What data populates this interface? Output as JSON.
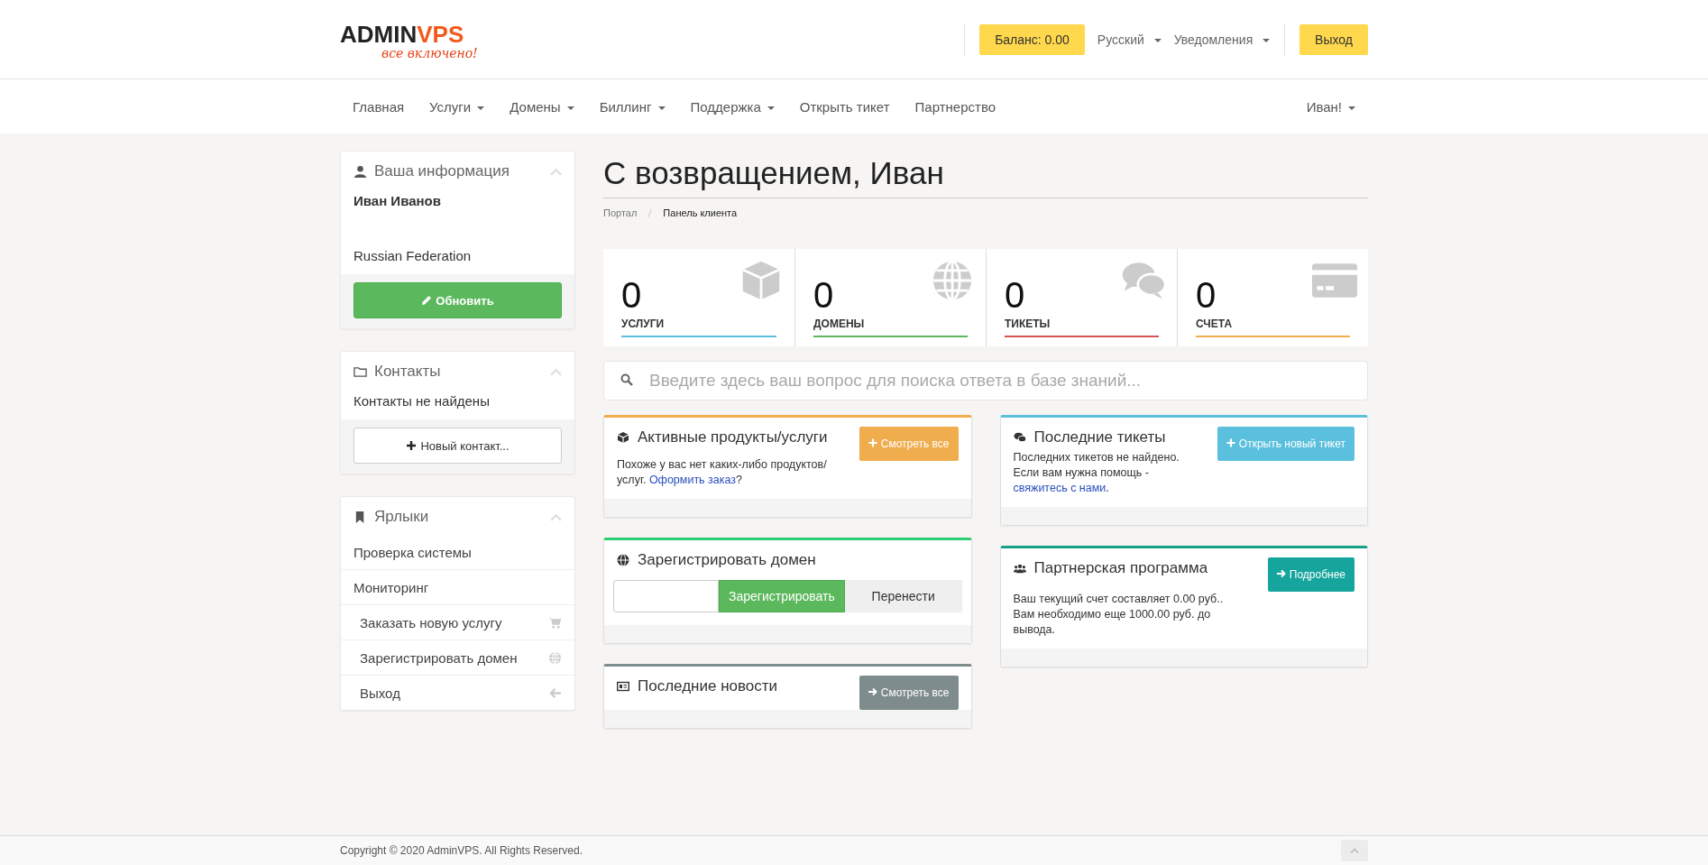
{
  "header": {
    "logo": {
      "name_start": "ADMIN",
      "name_end": "VPS",
      "tagline": "все включено!"
    },
    "balance_button": "Баланс: 0.00",
    "language": "Русский",
    "notifications": "Уведомления",
    "logout_button": "Выход"
  },
  "nav": {
    "items": [
      {
        "label": "Главная",
        "dropdown": false
      },
      {
        "label": "Услуги",
        "dropdown": true
      },
      {
        "label": "Домены",
        "dropdown": true
      },
      {
        "label": "Биллинг",
        "dropdown": true
      },
      {
        "label": "Поддержка",
        "dropdown": true
      },
      {
        "label": "Открыть тикет",
        "dropdown": false
      },
      {
        "label": "Партнерство",
        "dropdown": false
      }
    ],
    "user_menu": "Иван!"
  },
  "sidebar": {
    "your_info": {
      "title": "Ваша информация",
      "name": "Иван Иванов",
      "country": "Russian Federation",
      "update_button": "Обновить"
    },
    "contacts": {
      "title": "Контакты",
      "empty_text": "Контакты не найдены",
      "new_contact_button": "Новый контакт..."
    },
    "shortcuts": {
      "title": "Ярлыки",
      "items": [
        {
          "label": "Проверка системы",
          "kind": "plain"
        },
        {
          "label": "Мониторинг",
          "kind": "plain"
        },
        {
          "label": "Заказать новую услугу",
          "kind": "cart"
        },
        {
          "label": "Зарегистрировать домен",
          "kind": "globe"
        },
        {
          "label": "Выход",
          "kind": "back"
        }
      ]
    }
  },
  "main": {
    "title": "С возвращением, Иван",
    "breadcrumb": [
      {
        "label": "Портал",
        "selected": false
      },
      {
        "label": "Панель клиента",
        "selected": true
      }
    ],
    "stats": [
      {
        "count": "0",
        "label": "УСЛУГИ",
        "color": "#5bc0de",
        "kind": "box"
      },
      {
        "count": "0",
        "label": "ДОМЕНЫ",
        "color": "#5cb85c",
        "kind": "globe"
      },
      {
        "count": "0",
        "label": "ТИКЕТЫ",
        "color": "#d9534f",
        "kind": "chat"
      },
      {
        "count": "0",
        "label": "СЧЕТА",
        "color": "#f0ad4e",
        "kind": "card"
      }
    ],
    "search": {
      "placeholder": "Введите здесь ваш вопрос для поиска ответа в базе знаний..."
    },
    "panels_left": [
      {
        "kind": "products",
        "title": "Активные продукты/услуги",
        "color": "#f0ad4e",
        "button": "Смотреть все",
        "text": "Похоже у вас нет каких-либо продуктов/ услуг. ",
        "link": "Оформить заказ",
        "text_after": "?"
      },
      {
        "kind": "domain",
        "title": "Зарегистрировать домен",
        "color": "#2ecc71",
        "register_button": "Зарегистрировать",
        "transfer_button": "Перенести"
      },
      {
        "kind": "news",
        "title": "Последние новости",
        "color": "#7f8c8d",
        "button": "Смотреть все"
      }
    ],
    "panels_right": [
      {
        "kind": "tickets",
        "title": "Последние тикеты",
        "color": "#5bc0de",
        "button": "Открыть новый тикет",
        "text": "Последних тикетов не найдено. Если вам нужна помощь - ",
        "link": "свяжитесь с нами",
        "text_after": "."
      },
      {
        "kind": "affiliate",
        "title": "Партнерская программа",
        "color": "#16a085",
        "button": "Подробнее",
        "lines": [
          "Ваш текущий счет составляет 0.00 руб..",
          "Вам необходимо еще 1000.00 руб. до вывода."
        ]
      }
    ]
  },
  "footer": {
    "copyright": "Copyright © 2020 AdminVPS. All Rights Reserved."
  }
}
